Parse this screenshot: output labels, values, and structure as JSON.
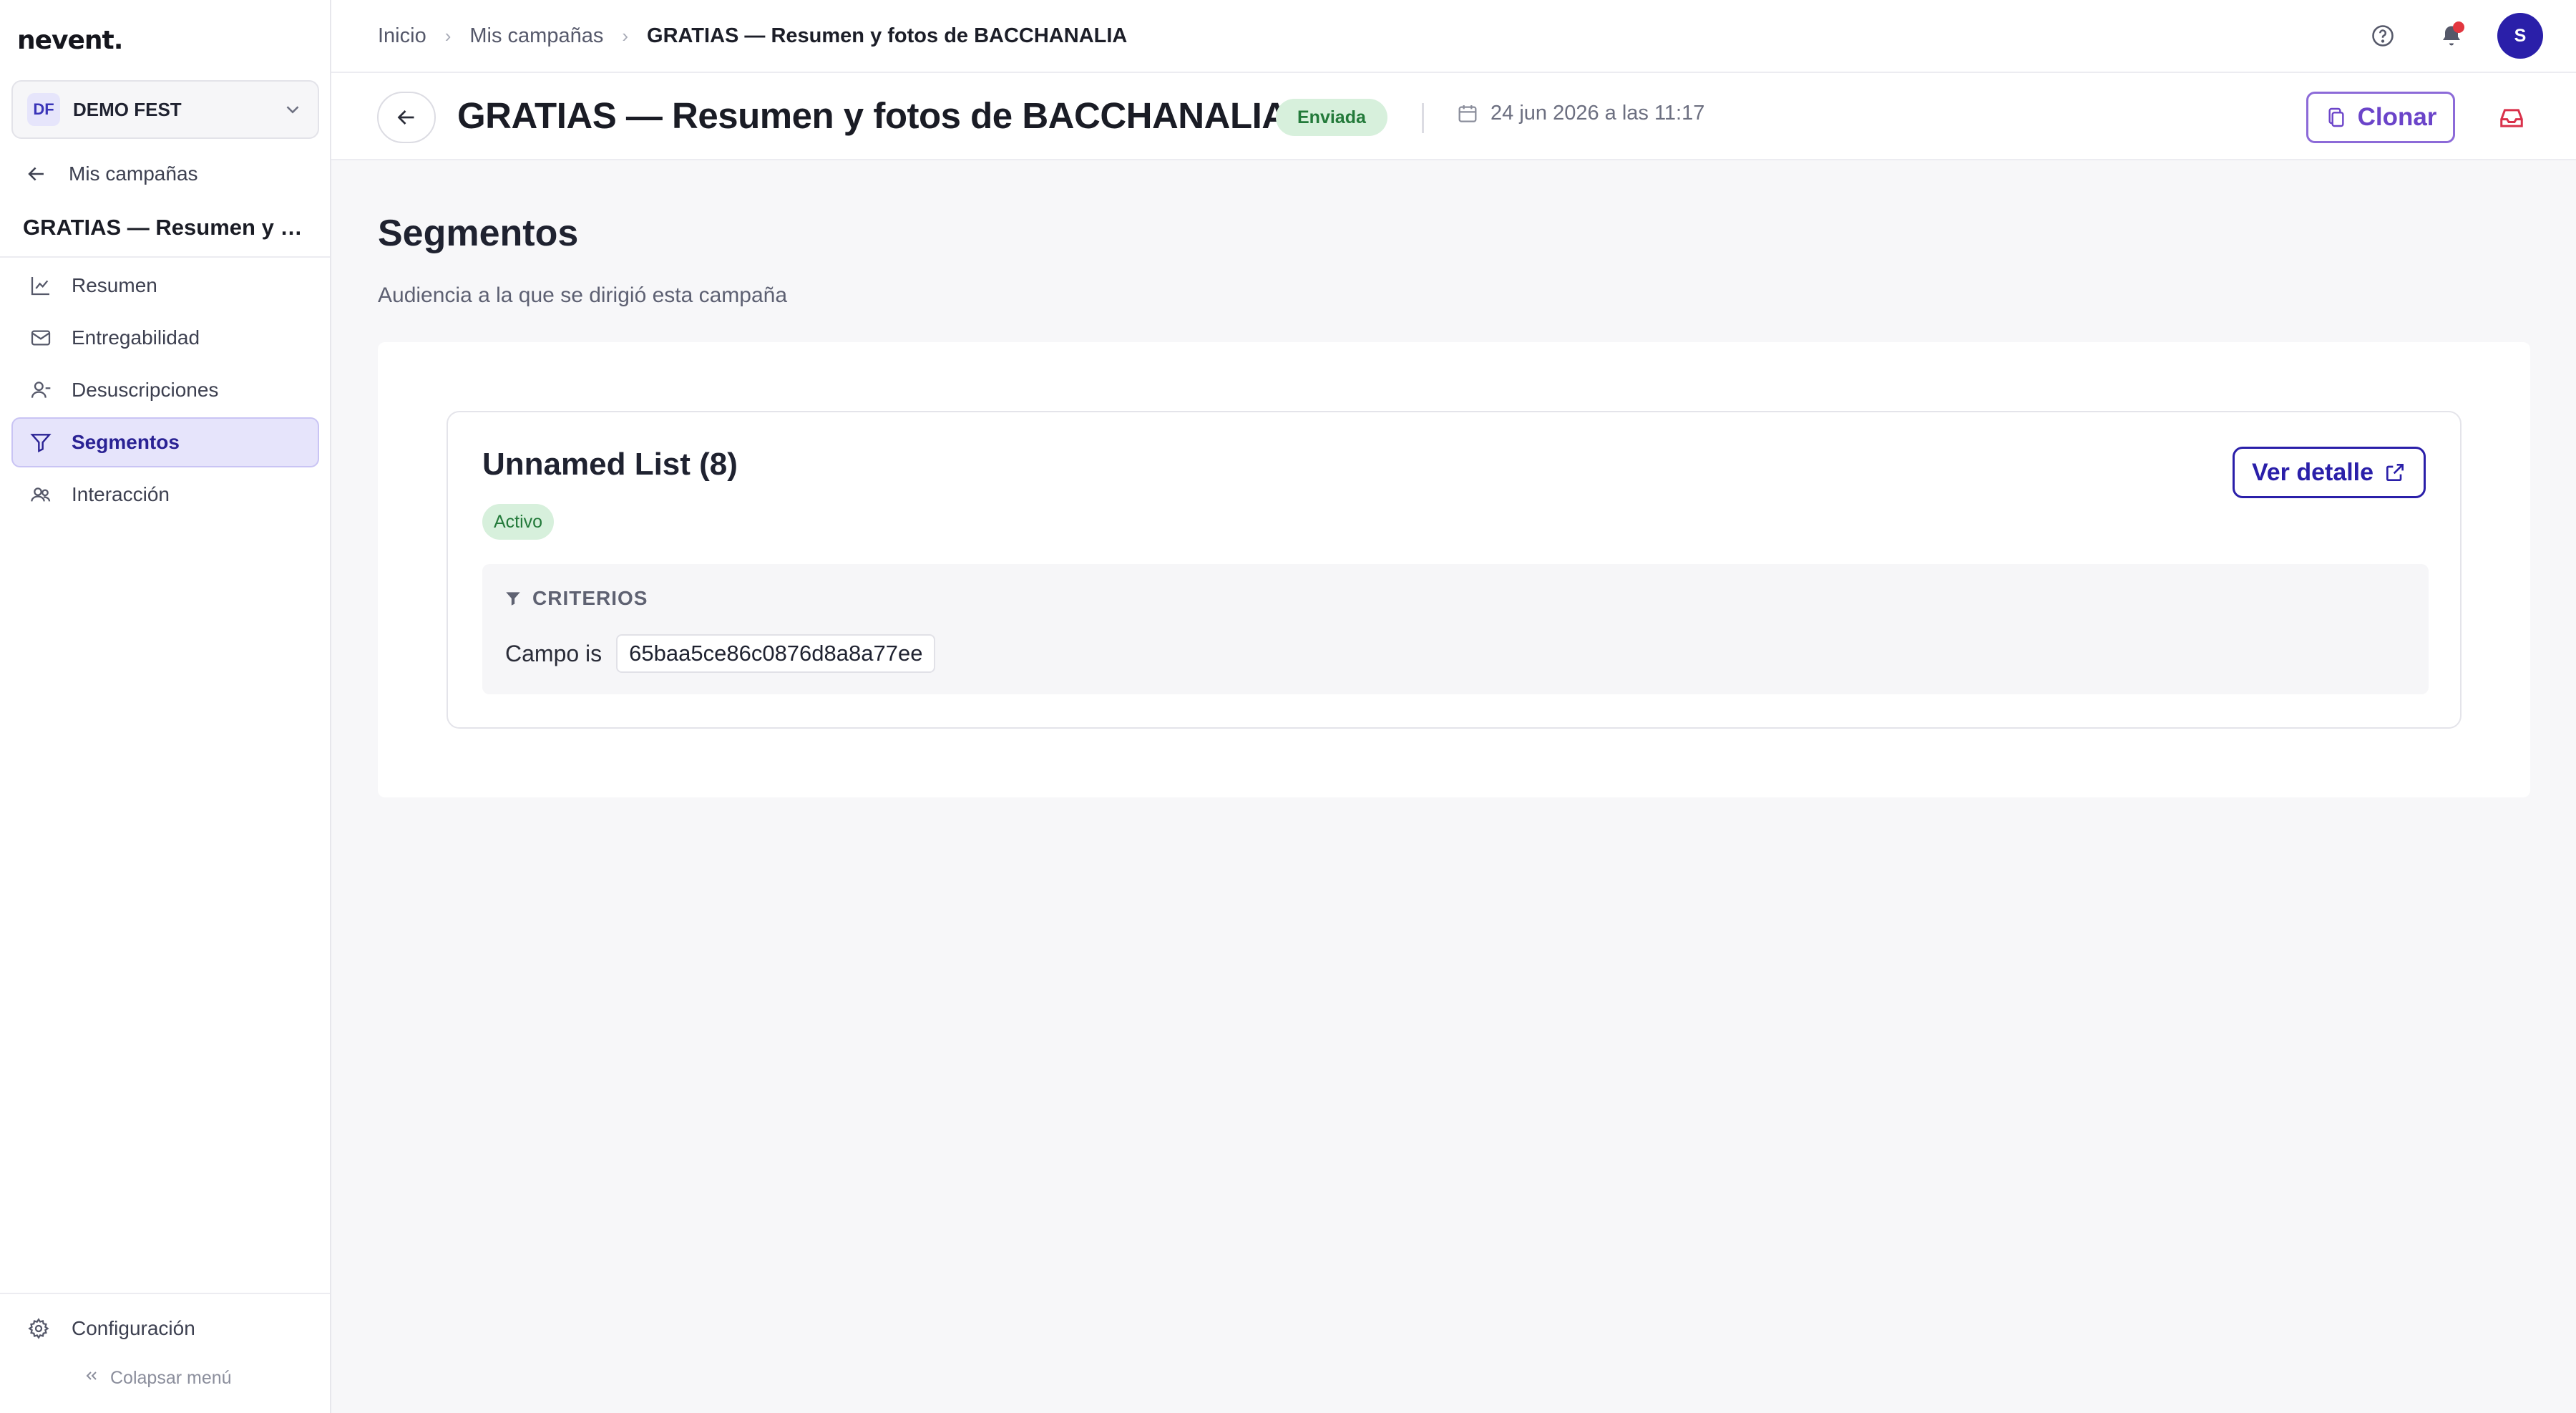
{
  "app": {
    "logo": "nevent."
  },
  "org": {
    "initials": "DF",
    "name": "DEMO FEST"
  },
  "sidebar": {
    "back_label": "Mis campañas",
    "campaign_name": "GRATIAS — Resumen y fotos de BACCHANALIA",
    "items": [
      {
        "label": "Resumen",
        "icon": "chart-icon"
      },
      {
        "label": "Entregabilidad",
        "icon": "mail-icon"
      },
      {
        "label": "Desuscripciones",
        "icon": "user-minus-icon"
      },
      {
        "label": "Segmentos",
        "icon": "filter-icon",
        "active": true
      },
      {
        "label": "Interacción",
        "icon": "users-icon"
      }
    ],
    "config_label": "Configuración",
    "collapse_label": "Colapsar menú"
  },
  "breadcrumb": {
    "items": [
      "Inicio",
      "Mis campañas"
    ],
    "current": "GRATIAS — Resumen y fotos de BACCHANALIA"
  },
  "header": {
    "title": "GRATIAS — Resumen y fotos de BACCHANALIA",
    "status": "Enviada",
    "sent_date": "24 jun 2026 a las 11:17",
    "clone_label": "Clonar"
  },
  "user": {
    "initial": "S"
  },
  "content": {
    "title": "Segmentos",
    "subtitle": "Audiencia a la que se dirigió esta campaña",
    "segment": {
      "name": "Unnamed List (8)",
      "status": "Activo",
      "detail_label": "Ver detalle",
      "criteria_title": "CRITERIOS",
      "criteria_field": "Campo is",
      "criteria_value": "65baa5ce86c0876d8a8a77ee"
    }
  },
  "colors": {
    "accent": "#2a1fa9",
    "purple": "#6b44c9",
    "success_bg": "#d7f0dc",
    "success_text": "#237a3a",
    "notification": "#e2363f",
    "danger": "#d9314a"
  }
}
